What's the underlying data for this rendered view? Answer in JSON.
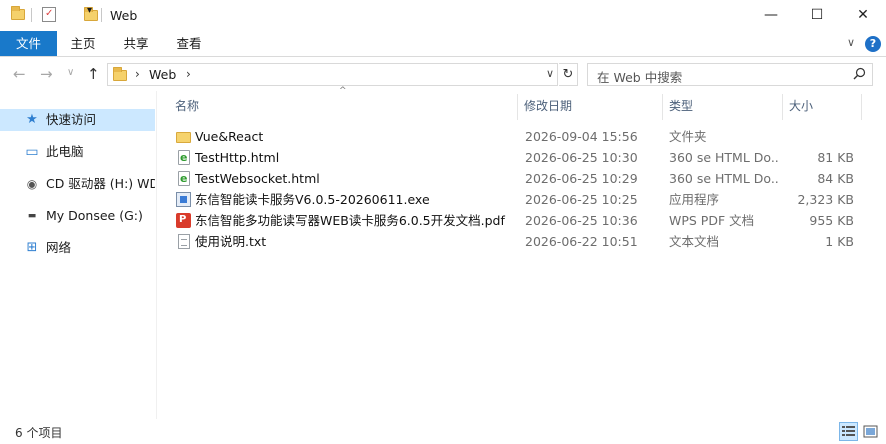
{
  "window": {
    "title": "Web",
    "minimize": "—",
    "maximize": "☐",
    "close": "✕"
  },
  "ribbon": {
    "tabs": [
      "文件",
      "主页",
      "共享",
      "查看"
    ],
    "expand": "∨",
    "help": "?"
  },
  "address": {
    "back": "←",
    "forward": "→",
    "recent": "∨",
    "up": "↑",
    "chevron": "›",
    "path": [
      "Web"
    ],
    "dropdown": "∨",
    "refresh": "↻"
  },
  "search": {
    "placeholder": "在 Web 中搜索",
    "icon": "⚲"
  },
  "nav": {
    "items": [
      {
        "icon": "pin-star-icon",
        "glyph": "★",
        "label": "快速访问",
        "selected": true
      },
      {
        "icon": "computer-icon",
        "glyph": "▭",
        "label": "此电脑"
      },
      {
        "icon": "cd-drive-icon",
        "glyph": "◉",
        "label": "CD 驱动器 (H:) WD"
      },
      {
        "icon": "drive-icon",
        "glyph": "▬",
        "label": "My Donsee (G:)"
      },
      {
        "icon": "network-icon",
        "glyph": "⊞",
        "label": "网络"
      }
    ]
  },
  "columns": {
    "name": "名称",
    "date": "修改日期",
    "type": "类型",
    "size": "大小",
    "sort_arrow": "^"
  },
  "files": [
    {
      "kind": "folder",
      "name": "Vue&React",
      "date": "2026-09-04 15:56",
      "type": "文件夹",
      "size": ""
    },
    {
      "kind": "html",
      "name": "TestHttp.html",
      "date": "2026-06-25 10:30",
      "type": "360 se HTML Do...",
      "size": "81 KB"
    },
    {
      "kind": "html",
      "name": "TestWebsocket.html",
      "date": "2026-06-25 10:29",
      "type": "360 se HTML Do...",
      "size": "84 KB"
    },
    {
      "kind": "exe",
      "name": "东信智能读卡服务V6.0.5-20260611.exe",
      "date": "2026-06-25 10:25",
      "type": "应用程序",
      "size": "2,323 KB"
    },
    {
      "kind": "pdf",
      "name": "东信智能多功能读写器WEB读卡服务6.0.5开发文档.pdf",
      "date": "2026-06-25 10:36",
      "type": "WPS PDF 文档",
      "size": "955 KB"
    },
    {
      "kind": "txt",
      "name": "使用说明.txt",
      "date": "2026-06-22 10:51",
      "type": "文本文档",
      "size": "1 KB"
    }
  ],
  "status": {
    "count": "6 个项目"
  },
  "colors": {
    "accent": "#1979ca",
    "selection": "#cce8ff"
  }
}
